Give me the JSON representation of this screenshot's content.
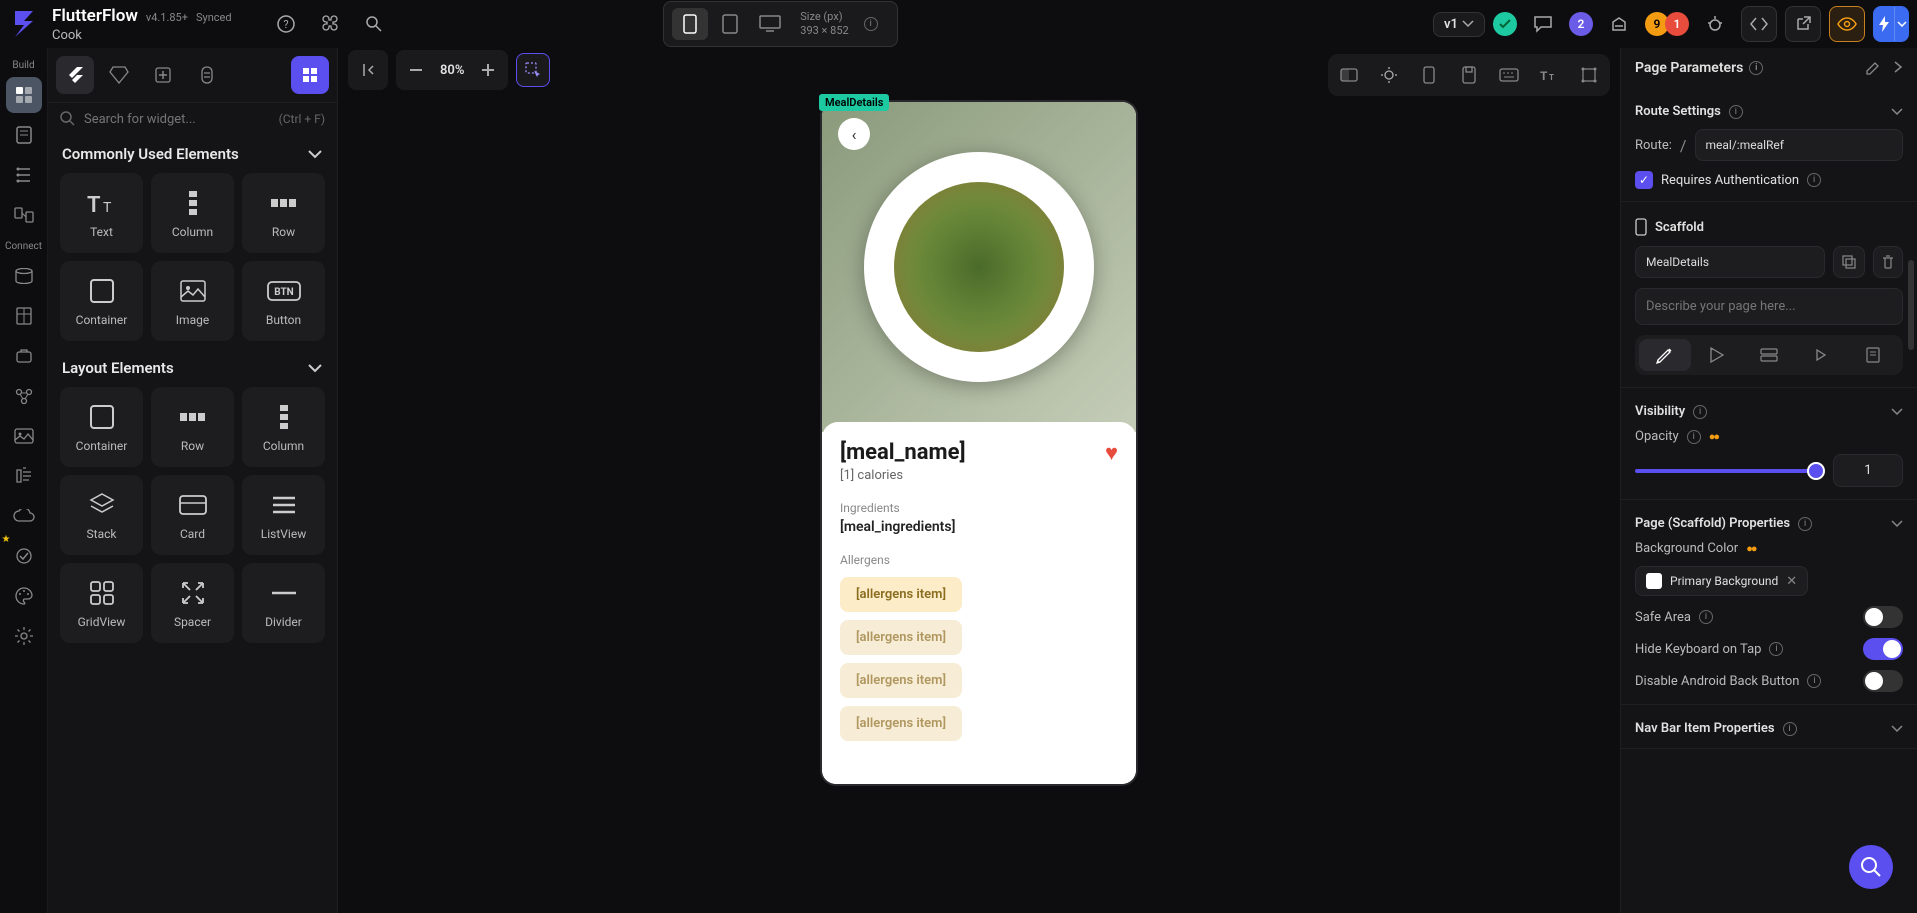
{
  "app": {
    "name": "FlutterFlow",
    "version": "v4.1.85+",
    "sync": "Synced",
    "project": "Cook"
  },
  "topbar": {
    "size_label": "Size (px)",
    "size_value": "393 × 852",
    "version_pill": "v1",
    "badge_purple": "2",
    "badge_orange": "9",
    "badge_red": "1"
  },
  "rail": {
    "build": "Build",
    "connect": "Connect"
  },
  "widget_panel": {
    "search_placeholder": "Search for widget...",
    "search_hint": "(Ctrl + F)",
    "section_common": "Commonly Used Elements",
    "section_layout": "Layout Elements",
    "common": [
      {
        "label": "Text",
        "icon": "Tᴛ"
      },
      {
        "label": "Column",
        "icon": "col"
      },
      {
        "label": "Row",
        "icon": "row"
      },
      {
        "label": "Container",
        "icon": "box"
      },
      {
        "label": "Image",
        "icon": "img"
      },
      {
        "label": "Button",
        "icon": "BTN"
      }
    ],
    "layout": [
      {
        "label": "Container",
        "icon": "box"
      },
      {
        "label": "Row",
        "icon": "row"
      },
      {
        "label": "Column",
        "icon": "col"
      },
      {
        "label": "Stack",
        "icon": "stack"
      },
      {
        "label": "Card",
        "icon": "card"
      },
      {
        "label": "ListView",
        "icon": "list"
      },
      {
        "label": "GridView",
        "icon": "grid"
      },
      {
        "label": "Spacer",
        "icon": "spacer"
      },
      {
        "label": "Divider",
        "icon": "div"
      }
    ]
  },
  "canvas": {
    "zoom": "80%",
    "page_tag": "MealDetails",
    "meal_name": "[meal_name]",
    "calories": "[1] calories",
    "ingredients_label": "Ingredients",
    "ingredients_value": "[meal_ingredients]",
    "allergens_label": "Allergens",
    "allergens": [
      "[allergens item]",
      "[allergens item]",
      "[allergens item]",
      "[allergens item]"
    ]
  },
  "props": {
    "page_params": "Page Parameters",
    "route_settings": "Route Settings",
    "route_label": "Route:",
    "route_value": "meal/:mealRef",
    "requires_auth": "Requires Authentication",
    "scaffold": "Scaffold",
    "scaffold_name": "MealDetails",
    "describe_placeholder": "Describe your page here...",
    "visibility": "Visibility",
    "opacity_label": "Opacity",
    "opacity_value": "1",
    "page_scaffold_props": "Page (Scaffold) Properties",
    "bg_color_label": "Background Color",
    "bg_color_name": "Primary Background",
    "safe_area": "Safe Area",
    "hide_kb": "Hide Keyboard on Tap",
    "disable_back": "Disable Android Back Button",
    "navbar_props": "Nav Bar Item Properties"
  }
}
